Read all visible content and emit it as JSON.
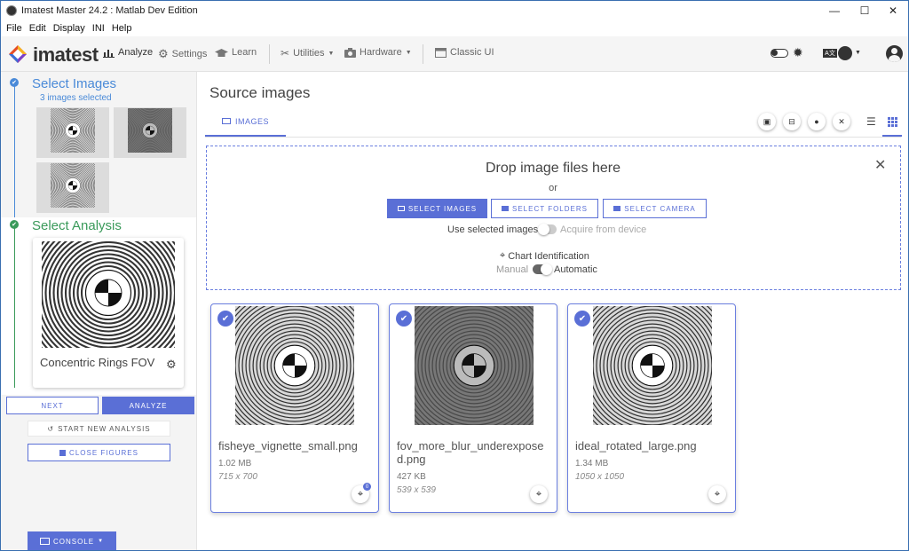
{
  "window": {
    "title": "Imatest Master 24.2 : Matlab Dev Edition",
    "minimize": "—",
    "maximize": "☐",
    "close": "✕"
  },
  "menu": [
    "File",
    "Edit",
    "Display",
    "INI",
    "Help"
  ],
  "toolbar": {
    "logo": "imatest",
    "analyze": "Analyze",
    "settings": "Settings",
    "learn": "Learn",
    "utilities": "Utilities",
    "hardware": "Hardware",
    "classic_ui": "Classic UI"
  },
  "sidebar": {
    "select_images_title": "Select Images",
    "images_selected": "3 images selected",
    "select_analysis_title": "Select Analysis",
    "analysis_name": "Concentric Rings FOV",
    "next": "NEXT",
    "analyze": "ANALYZE",
    "start_new": "START NEW ANALYSIS",
    "close_figures": "CLOSE FIGURES",
    "console": "CONSOLE"
  },
  "main": {
    "title": "Source images",
    "tab_images": "IMAGES",
    "drop_title": "Drop image files here",
    "drop_or": "or",
    "select_images": "SELECT IMAGES",
    "select_folders": "SELECT FOLDERS",
    "select_camera": "SELECT CAMERA",
    "use_selected": "Use selected images",
    "acquire_device": "Acquire from device",
    "chart_identification": "Chart Identification",
    "manual": "Manual",
    "automatic": "Automatic",
    "badge": "0"
  },
  "images": [
    {
      "name": "fisheye_vignette_small.png",
      "size": "1.02 MB",
      "dims": "715 x 700",
      "tone": "light"
    },
    {
      "name": "fov_more_blur_underexposed.png",
      "size": "427 KB",
      "dims": "539 x 539",
      "tone": "dark"
    },
    {
      "name": "ideal_rotated_large.png",
      "size": "1.34 MB",
      "dims": "1050 x 1050",
      "tone": "light"
    }
  ],
  "colors": {
    "accent": "#5a6fd6",
    "step_done": "#3a9a5a",
    "step_active": "#4a8ad8"
  }
}
